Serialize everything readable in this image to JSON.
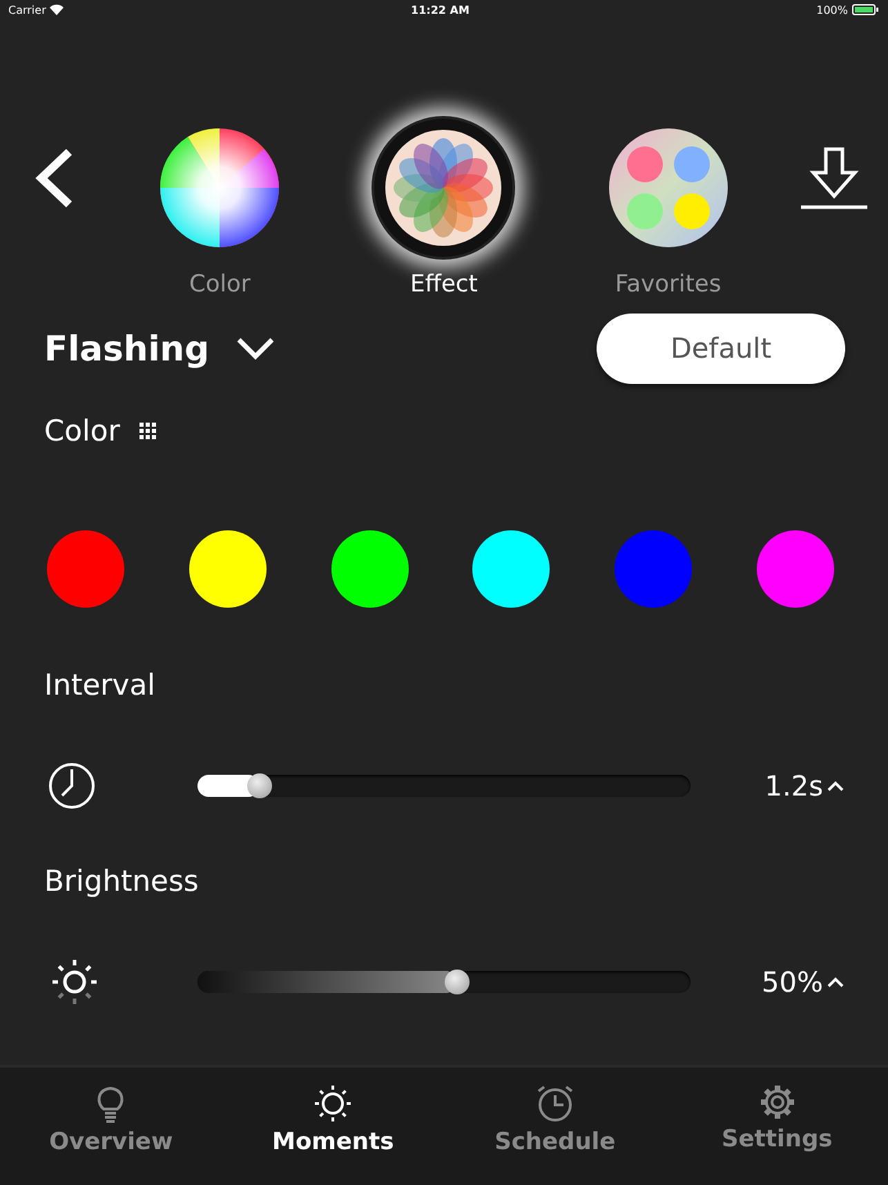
{
  "status_bar": {
    "carrier": "Carrier",
    "time": "11:22 AM",
    "battery": "100%"
  },
  "modes": [
    {
      "kind": "wheel",
      "label": "Color",
      "selected": false
    },
    {
      "kind": "flower",
      "label": "Effect",
      "selected": true
    },
    {
      "kind": "favorites",
      "label": "Favorites",
      "selected": false
    }
  ],
  "effect": {
    "name": "Flashing",
    "button": "Default"
  },
  "color_section": {
    "title": "Color",
    "swatches": [
      {
        "color": "#ff0000"
      },
      {
        "color": "#ffff00"
      },
      {
        "color": "#00ff00"
      },
      {
        "color": "#00ffff"
      },
      {
        "color": "#0000ff"
      },
      {
        "color": "#ff00ff"
      }
    ]
  },
  "settings": [
    {
      "title": "Interval",
      "kind": "clock",
      "level": 0.1,
      "reading": "1.2s"
    },
    {
      "title": "Brightness",
      "kind": "sun",
      "level": 0.5,
      "reading": "50%"
    }
  ],
  "tab_bar": [
    {
      "kind": "bulb",
      "label": "Overview",
      "selected": false
    },
    {
      "kind": "sun",
      "label": "Moments",
      "selected": true
    },
    {
      "kind": "alarm",
      "label": "Schedule",
      "selected": false
    },
    {
      "kind": "gear",
      "label": "Settings",
      "selected": false
    }
  ]
}
